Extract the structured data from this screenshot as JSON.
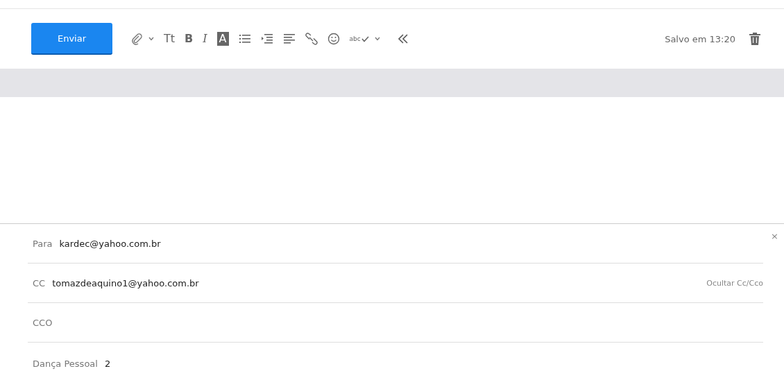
{
  "toolbar": {
    "send_button": "Enviar",
    "tools": [
      {
        "kind": "attach"
      },
      {
        "kind": "caret"
      },
      {
        "kind": "fontsize",
        "label": "Tt"
      },
      {
        "kind": "bold",
        "label": "B"
      },
      {
        "kind": "italic",
        "label": "I"
      },
      {
        "kind": "highlight",
        "label": "A"
      },
      {
        "kind": "bullets"
      },
      {
        "kind": "indent"
      },
      {
        "kind": "align"
      },
      {
        "kind": "link"
      },
      {
        "kind": "emoji"
      },
      {
        "kind": "spell",
        "label": "abc"
      },
      {
        "kind": "caret"
      },
      {
        "kind": "collapse"
      }
    ],
    "saved": "Salvo em 13:20"
  },
  "close": "×",
  "fields": [
    {
      "label": "Para",
      "value": "kardec@yahoo.com.br"
    },
    {
      "label": "CC",
      "value": "tomazdeaquino1@yahoo.com.br",
      "action": "Ocultar Cc/Cco"
    },
    {
      "label": "CCO"
    },
    {
      "label": "Dança Pessoal",
      "value": "2"
    }
  ]
}
